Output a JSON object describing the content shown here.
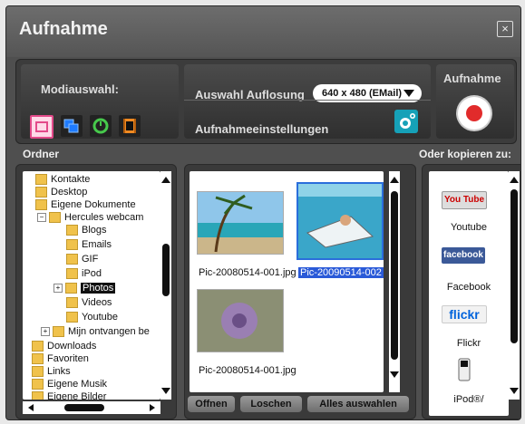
{
  "window": {
    "title": "Aufnahme",
    "close_label": "×"
  },
  "toolbar": {
    "mode_label": "Modiauswahl:",
    "resolution_label": "Auswahl Auflosung",
    "resolution_value": "640 x 480 (EMail)",
    "settings_label": "Aufnahmeeinstellungen",
    "record_label": "Aufnahme"
  },
  "panels": {
    "folders_label": "Ordner",
    "copy_label": "Oder kopieren zu:"
  },
  "tree": [
    {
      "label": "Kontakte"
    },
    {
      "label": "Desktop"
    },
    {
      "label": "Eigene Dokumente"
    },
    {
      "label": "Hercules webcam"
    },
    {
      "label": "Blogs"
    },
    {
      "label": "Emails"
    },
    {
      "label": "GIF"
    },
    {
      "label": "iPod"
    },
    {
      "label": "Photos"
    },
    {
      "label": "Videos"
    },
    {
      "label": "Youtube"
    },
    {
      "label": "Mijn ontvangen be"
    },
    {
      "label": "Downloads"
    },
    {
      "label": "Favoriten"
    },
    {
      "label": "Links"
    },
    {
      "label": "Eigene Musik"
    },
    {
      "label": "Eigene Bilder"
    }
  ],
  "files": [
    {
      "name": "Pic-20080514-001.jpg"
    },
    {
      "name": "Pic-20090514-002"
    },
    {
      "name": "Pic-20080514-001.jpg"
    }
  ],
  "file_buttons": {
    "open": "Offnen",
    "delete": "Loschen",
    "select_all": "Alles auswahlen"
  },
  "copy_targets": [
    {
      "label": "Youtube",
      "logo": "You Tube"
    },
    {
      "label": "Facebook",
      "logo": "facebook"
    },
    {
      "label": "Flickr",
      "logo": "flickr"
    },
    {
      "label": "iPod®/"
    }
  ]
}
